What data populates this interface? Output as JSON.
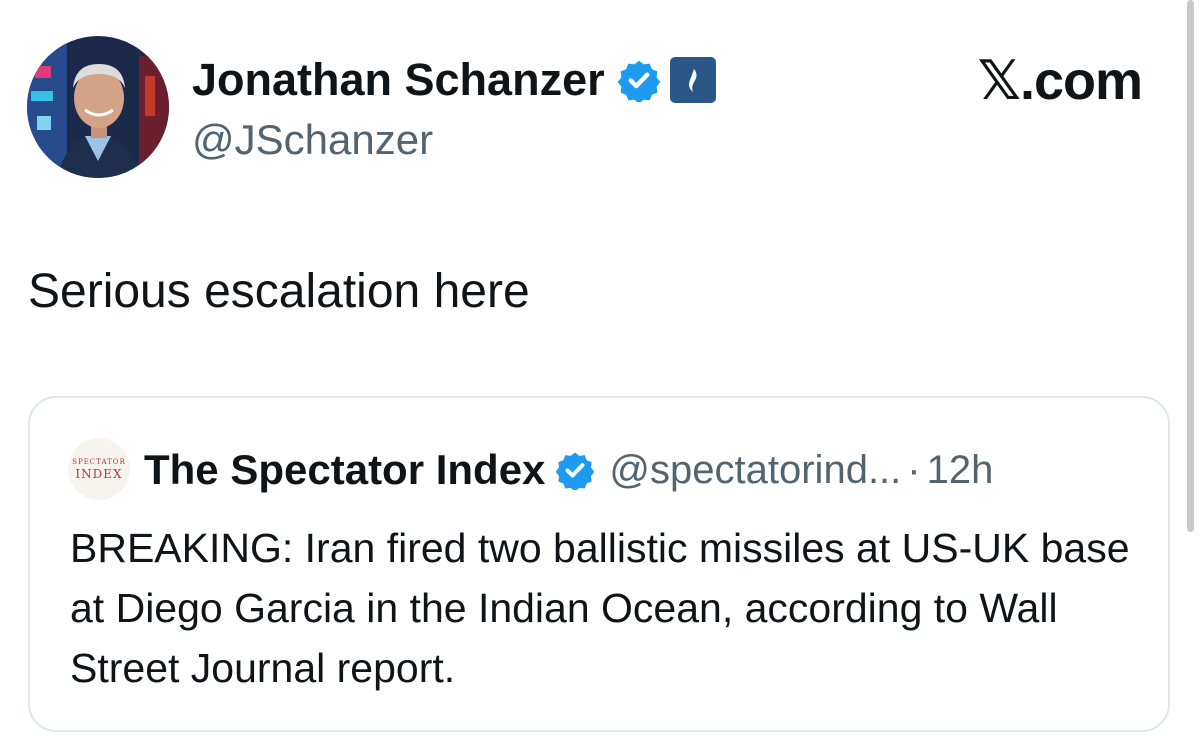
{
  "author": {
    "display_name": "Jonathan Schanzer",
    "handle": "@JSchanzer",
    "avatar_icon": "profile-photo",
    "verified_icon": "verified-check-icon",
    "affiliation_icon": "affiliation-badge-icon"
  },
  "brand": {
    "label": "𝕏.com"
  },
  "tweet": {
    "text": "Serious escalation here"
  },
  "quote": {
    "avatar_text_top": "SPECTATOR",
    "avatar_text_bottom": "INDEX",
    "display_name": "The Spectator Index",
    "handle": "@spectatorind...",
    "separator": "·",
    "time": "12h",
    "body": "BREAKING: Iran fired two ballistic missiles at US-UK base at Diego Garcia in the Indian Ocean, according to Wall Street Journal report."
  },
  "colors": {
    "verified_blue": "#1d9bf0",
    "muted_text": "#536471",
    "card_border": "#e1e6ea",
    "affiliation_bg": "#2a5688"
  }
}
